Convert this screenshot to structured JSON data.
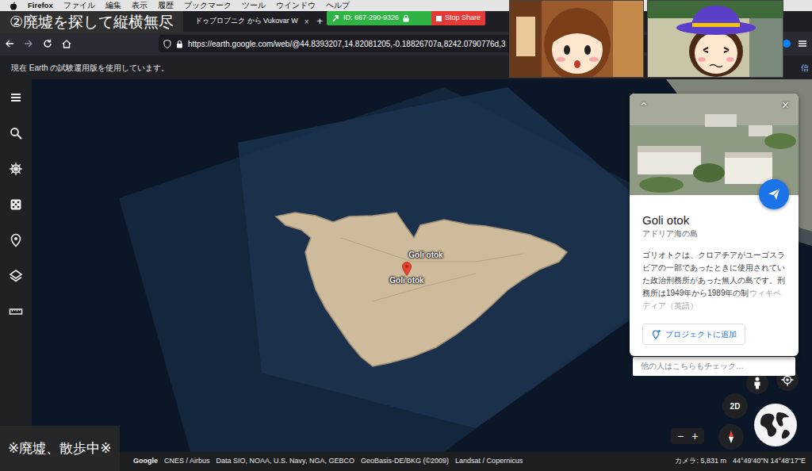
{
  "menubar": {
    "items": [
      {
        "label": "Firefox",
        "bold": true
      },
      {
        "label": "ファイル",
        "bold": false
      },
      {
        "label": "編集",
        "bold": false
      },
      {
        "label": "表示",
        "bold": false
      },
      {
        "label": "履歴",
        "bold": false
      },
      {
        "label": "ブックマーク",
        "bold": false
      },
      {
        "label": "ツール",
        "bold": false
      },
      {
        "label": "ウインドウ",
        "bold": false
      },
      {
        "label": "ヘルプ",
        "bold": false
      }
    ]
  },
  "overlay": {
    "top_caption": "②廃墟を探して縦横無尽",
    "bottom_caption": "※廃墟、散歩中※"
  },
  "share_bar": {
    "id": "ID: 667-290-9326",
    "stop_button": "Stop Share"
  },
  "tabs": [
    {
      "label": "ドゥブロブニク から Vukovar W",
      "selected": false,
      "close": "×"
    }
  ],
  "new_tab": "+",
  "address_bar": {
    "host": "https://earth.google.com",
    "path": "/web/@44.8393207,14.82081205,-0.18826707a,8242.0790776d,3"
  },
  "notice": {
    "text": "現在 Earth の試験運用版を使用しています。",
    "link": "信"
  },
  "map": {
    "labels": [
      "Goli otok",
      "Goli otok"
    ]
  },
  "place_card": {
    "chevron": "⌃",
    "close": "×",
    "title": "Goli otok",
    "subtitle": "アドリア海の島",
    "description": "ゴリオトクは、クロアチアがユーゴスラビアの一部であったときに使用されていた政治刑務所があった無人の島です。刑務所は1949年から1989年の制",
    "source": "ウィキペディア（英語）",
    "add_button": "プロジェクトに追加"
  },
  "related": {
    "label": "他の人はこちらもチェック…"
  },
  "controls": {
    "mode": "2D",
    "zoom_out": "−",
    "zoom_in": "+"
  },
  "status_bar": {
    "logo": "Google",
    "attributions": [
      "CNES / Airbus",
      "Data SIO, NOAA, U.S. Navy, NGA, GEBCO",
      "GeoBasis-DE/BKG (©2009)",
      "Landsat / Copernicus"
    ],
    "camera": "カメラ: 5,831 m",
    "coordinates": "44°49'40\"N 14°48'17\"E"
  }
}
